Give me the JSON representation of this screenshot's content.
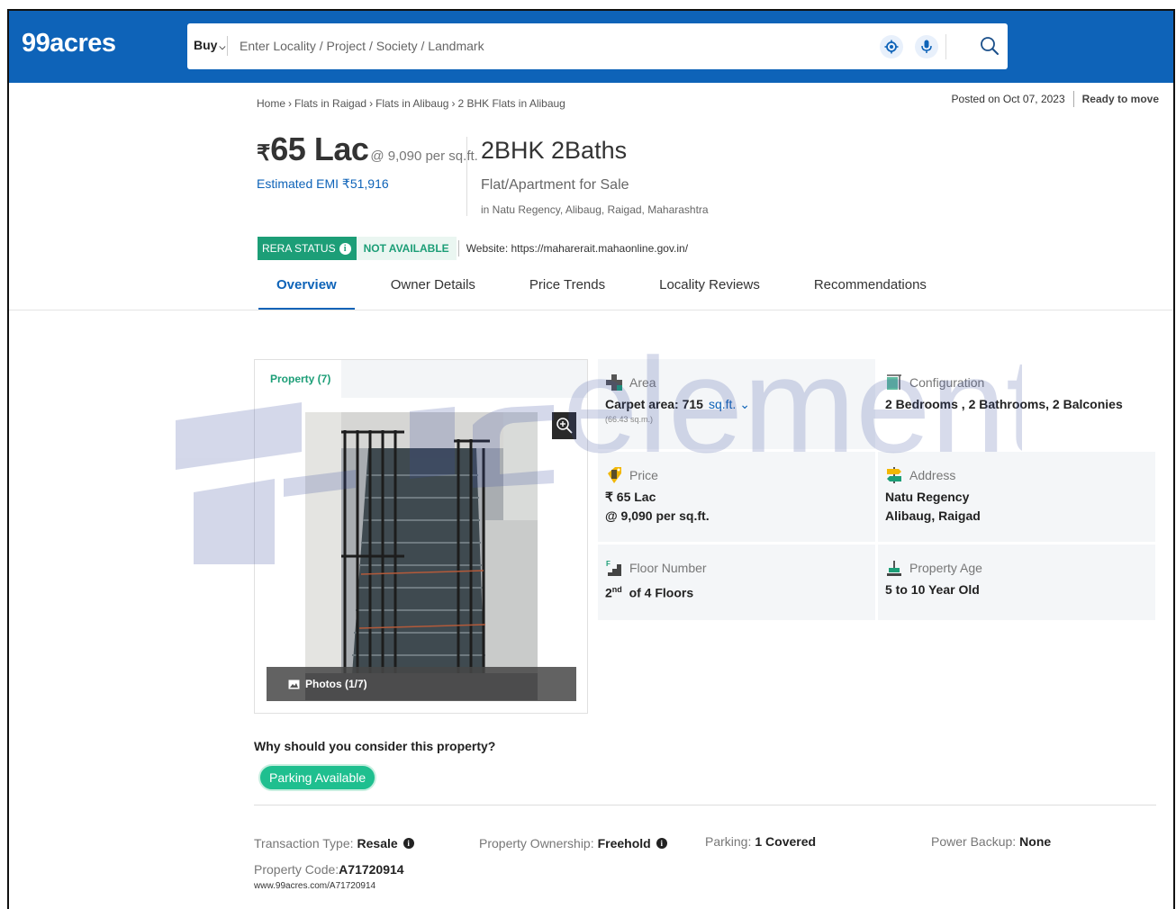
{
  "header": {
    "logo": "99acres",
    "buy_label": "Buy",
    "search_placeholder": "Enter Locality / Project / Society / Landmark",
    "colors": {
      "brand": "#0e63b8",
      "accent_green": "#1c9e77"
    }
  },
  "breadcrumb": [
    "Home",
    "Flats in Raigad",
    "Flats in Alibaug",
    "2 BHK Flats in Alibaug"
  ],
  "posted": {
    "date": "Posted on Oct 07, 2023",
    "status": "Ready to move"
  },
  "price": {
    "symbol": "₹",
    "amount": "65 Lac",
    "rate": "@ 9,090 per sq.ft.",
    "emi": "Estimated EMI ₹51,916"
  },
  "listing": {
    "config": "2BHK 2Baths",
    "type": "Flat/Apartment for Sale",
    "locality": "in Natu Regency, Alibaug, Raigad, Maharashtra"
  },
  "rera": {
    "badge": "RERA STATUS",
    "status": "NOT AVAILABLE",
    "website": "Website: https://maharerait.mahaonline.gov.in/"
  },
  "tabs": [
    "Overview",
    "Owner Details",
    "Price Trends",
    "Locality Reviews",
    "Recommendations"
  ],
  "photos": {
    "tab": "Property (7)",
    "counter": "Photos (1/7)"
  },
  "features": {
    "area": {
      "label": "Area",
      "value": "Carpet area: 715",
      "unit": "sq.ft.",
      "sub": "(66.43 sq.m.)"
    },
    "configuration": {
      "label": "Configuration",
      "value": "2 Bedrooms , 2 Bathrooms, 2 Balconies"
    },
    "price": {
      "label": "Price",
      "line1": "₹ 65 Lac",
      "line2": "@ 9,090 per sq.ft."
    },
    "address": {
      "label": "Address",
      "line1": "Natu Regency",
      "line2": "Alibaug, Raigad"
    },
    "floor": {
      "label": "Floor Number",
      "floor": "2",
      "suffix": "nd",
      "total": "of 4 Floors"
    },
    "age": {
      "label": "Property Age",
      "value": "5 to 10 Year Old"
    }
  },
  "why": {
    "heading": "Why should you consider this property?",
    "chips": [
      "Parking Available"
    ]
  },
  "meta": {
    "transaction_label": "Transaction Type:",
    "transaction_value": "Resale",
    "ownership_label": "Property Ownership:",
    "ownership_value": "Freehold",
    "parking_label": "Parking:",
    "parking_value": "1 Covered",
    "backup_label": "Power Backup:",
    "backup_value": "None",
    "code_label": "Property Code:",
    "code_value": "A71720914",
    "url": "www.99acres.com/A71720914"
  },
  "watermark": "element"
}
